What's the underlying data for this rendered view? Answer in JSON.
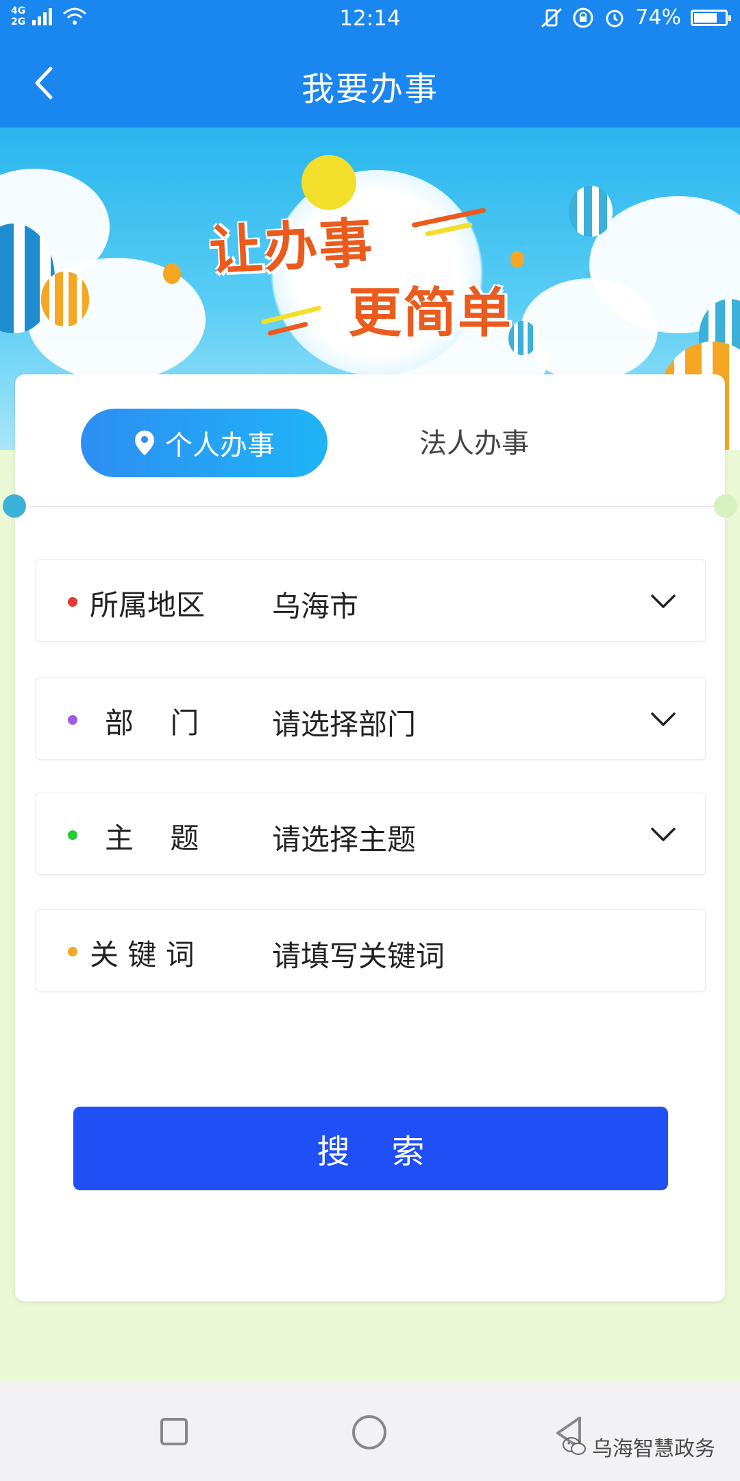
{
  "status_bar": {
    "network_top": "4G",
    "network_bottom": "2G",
    "time": "12:14",
    "battery": "74%",
    "battery_level": 0.74
  },
  "header": {
    "title": "我要办事"
  },
  "banner": {
    "slogan_line1": "让办事",
    "slogan_line2": "更简单"
  },
  "tabs": {
    "personal": "个人办事",
    "legal": "法人办事",
    "active": "personal"
  },
  "fields": {
    "region": {
      "label": "所属地区",
      "value": "乌海市",
      "dot_color": "#e53935"
    },
    "department": {
      "label": "部    门",
      "value": "请选择部门",
      "dot_color": "#9b5de5"
    },
    "topic": {
      "label": "主    题",
      "value": "请选择主题",
      "dot_color": "#22cc33"
    },
    "keyword": {
      "label": "关 键 词",
      "placeholder": "请填写关键词",
      "dot_color": "#f5a623"
    }
  },
  "search_button": {
    "label": "搜    索"
  },
  "watermark": {
    "text": "乌海智慧政务"
  },
  "colors": {
    "primary": "#1a86f0",
    "button": "#1f4ff5",
    "slogan": "#ea5b1d"
  }
}
